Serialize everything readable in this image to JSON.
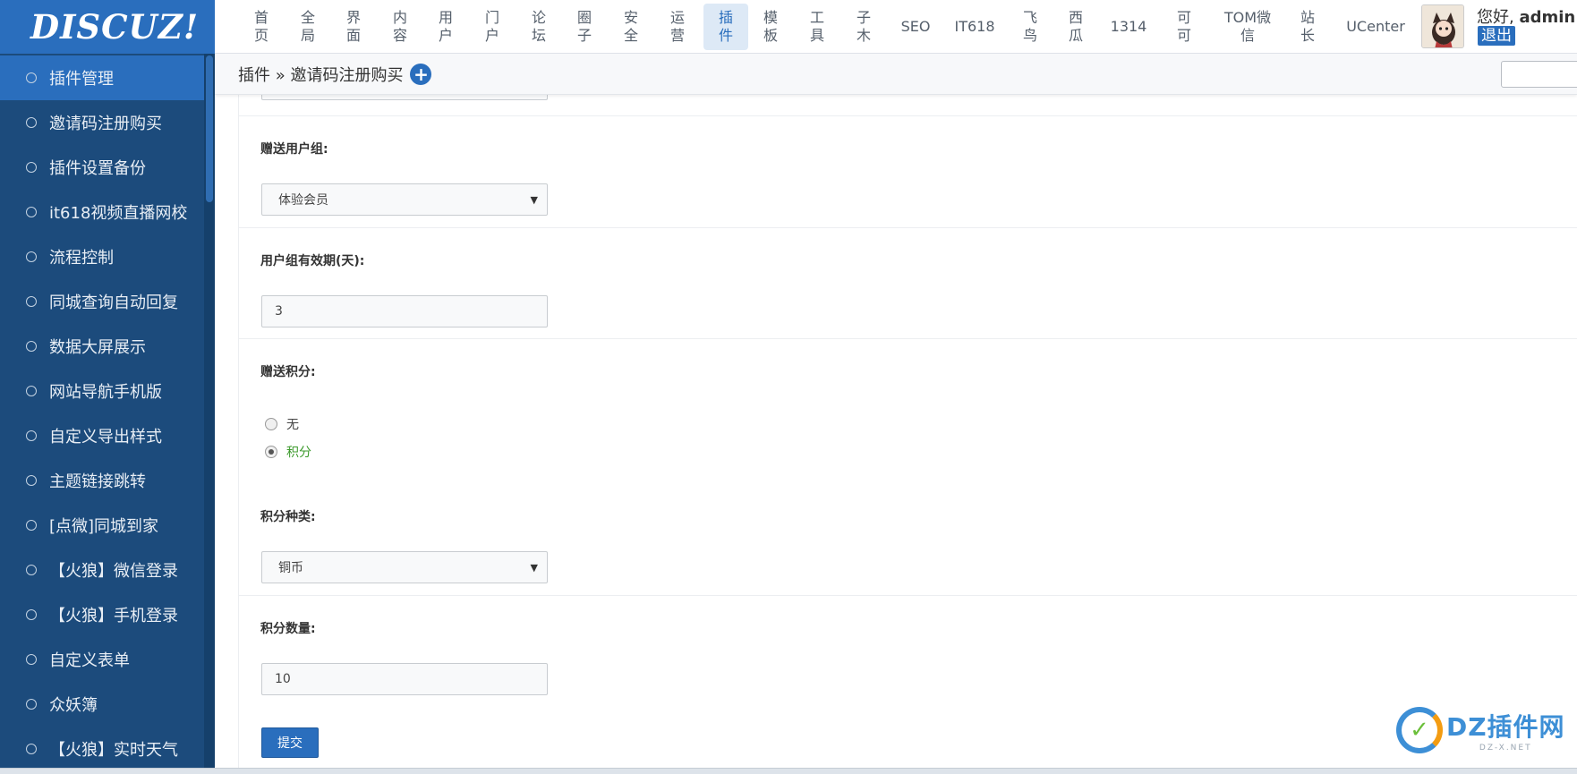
{
  "logo": {
    "text": "DISCUZ!"
  },
  "topnav": {
    "items": [
      {
        "label": "首\n页",
        "active": false
      },
      {
        "label": "全\n局",
        "active": false
      },
      {
        "label": "界\n面",
        "active": false
      },
      {
        "label": "内\n容",
        "active": false
      },
      {
        "label": "用\n户",
        "active": false
      },
      {
        "label": "门\n户",
        "active": false
      },
      {
        "label": "论\n坛",
        "active": false
      },
      {
        "label": "圈\n子",
        "active": false
      },
      {
        "label": "安\n全",
        "active": false
      },
      {
        "label": "运\n营",
        "active": false
      },
      {
        "label": "插\n件",
        "active": true
      },
      {
        "label": "模\n板",
        "active": false
      },
      {
        "label": "工\n具",
        "active": false
      },
      {
        "label": "子\n木",
        "active": false
      },
      {
        "label": "SEO",
        "active": false
      },
      {
        "label": "IT618",
        "active": false
      },
      {
        "label": "飞\n鸟",
        "active": false
      },
      {
        "label": "西\n瓜",
        "active": false
      },
      {
        "label": "1314",
        "active": false
      },
      {
        "label": "可\n可",
        "active": false
      },
      {
        "label": "TOM微\n信",
        "active": false
      },
      {
        "label": "站\n长",
        "active": false
      },
      {
        "label": "UCenter",
        "active": false
      }
    ],
    "greeting_prefix": "您好, ",
    "username": "admin",
    "logout_label": "退出"
  },
  "sidebar": {
    "items": [
      {
        "label": "插件管理",
        "active": true
      },
      {
        "label": "邀请码注册购买",
        "active": false
      },
      {
        "label": "插件设置备份",
        "active": false
      },
      {
        "label": "it618视频直播网校",
        "active": false
      },
      {
        "label": "流程控制",
        "active": false
      },
      {
        "label": "同城查询自动回复",
        "active": false
      },
      {
        "label": "数据大屏展示",
        "active": false
      },
      {
        "label": "网站导航手机版",
        "active": false
      },
      {
        "label": "自定义导出样式",
        "active": false
      },
      {
        "label": "主题链接跳转",
        "active": false
      },
      {
        "label": "[点微]同城到家",
        "active": false
      },
      {
        "label": "【火狼】微信登录",
        "active": false
      },
      {
        "label": "【火狼】手机登录",
        "active": false
      },
      {
        "label": "自定义表单",
        "active": false
      },
      {
        "label": "众妖簿",
        "active": false
      },
      {
        "label": "【火狼】实时天气",
        "active": false
      }
    ]
  },
  "breadcrumb": {
    "text": "插件 » 邀请码注册购买",
    "plus_icon": "+"
  },
  "form": {
    "group_label": "赠送用户组:",
    "group_value": "体验会员",
    "validity_label": "用户组有效期(天):",
    "validity_value": "3",
    "credit_label": "赠送积分:",
    "credit_options": [
      {
        "label": "无",
        "checked": false
      },
      {
        "label": "积分",
        "checked": true
      }
    ],
    "credit_type_label": "积分种类:",
    "credit_type_value": "铜币",
    "credit_amount_label": "积分数量:",
    "credit_amount_value": "10",
    "submit_label": "提交",
    "select_arrow": "▼"
  },
  "watermark": {
    "main": "DZ插件网",
    "sub": "DZ-X.NET",
    "icon_glyph": "✓"
  },
  "colors": {
    "brand": "#2a6ebd",
    "sidebar": "#1c4b7c",
    "checked_radio": "#3c9a2c"
  }
}
